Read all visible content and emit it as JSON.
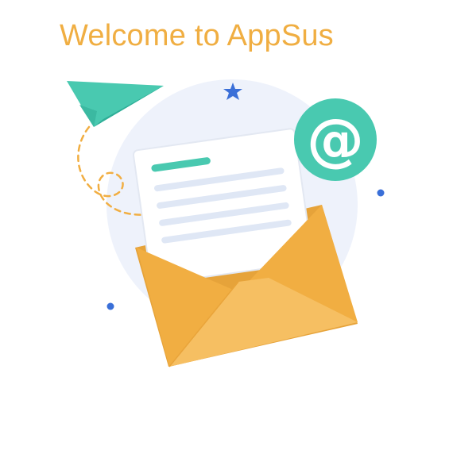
{
  "header": {
    "title": "Welcome to AppSus"
  },
  "illustration": {
    "icons": [
      "paper-plane-icon",
      "envelope-icon",
      "at-sign-icon",
      "star-icon"
    ],
    "at_symbol": "@"
  },
  "colors": {
    "title": "#f0ae42",
    "teal": "#49c9b0",
    "envelope": "#f1ae42",
    "envelope_flap": "#f6bf62",
    "circle_bg": "#eef2fb",
    "letter_lines": "#dfe7f5",
    "accent_blue": "#3a6fd8"
  }
}
